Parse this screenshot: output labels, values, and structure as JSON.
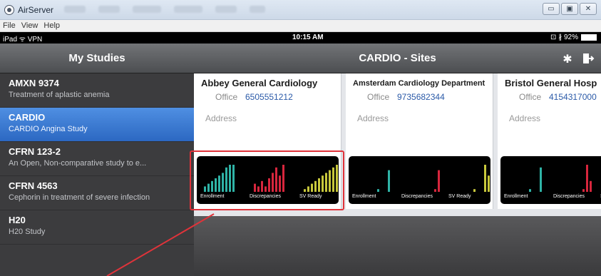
{
  "window": {
    "title": "AirServer",
    "menu": [
      "File",
      "View",
      "Help"
    ]
  },
  "status_bar": {
    "left": "iPad ᯤ VPN",
    "time": "10:15 AM",
    "battery": "⊡ ∦ 92%"
  },
  "left_panel": {
    "title": "My Studies",
    "studies": [
      {
        "name": "AMXN 9374",
        "desc": "Treatment of aplastic anemia"
      },
      {
        "name": "CARDIO",
        "desc": "CARDIO Angina Study"
      },
      {
        "name": "CFRN 123-2",
        "desc": "An Open, Non-comparative study to e..."
      },
      {
        "name": "CFRN 4563",
        "desc": "Cephorin in treatment of severe infection"
      },
      {
        "name": "H20",
        "desc": "H20 Study"
      }
    ]
  },
  "right_panel": {
    "title": "CARDIO - Sites",
    "sites": [
      {
        "name": "Abbey General Cardiology",
        "office_label": "Office",
        "phone": "6505551212",
        "address_label": "Address",
        "chart_labels": [
          "Enrollment",
          "Discrepancies",
          "SV Ready"
        ]
      },
      {
        "name": "Amsterdam Cardiology Department",
        "office_label": "Office",
        "phone": "9735682344",
        "address_label": "Address",
        "chart_labels": [
          "Enrollment",
          "Discrepancies",
          "SV Ready"
        ]
      },
      {
        "name": "Bristol General Hosp",
        "office_label": "Office",
        "phone": "4154317000",
        "address_label": "Address",
        "chart_labels": [
          "Enrollment",
          "Discrepancies",
          "S"
        ]
      }
    ]
  },
  "colors": {
    "enrollment": "#2fb3a6",
    "discrepancies": "#d7263d",
    "sv_ready": "#c8c83c",
    "accent": "#2c68c2"
  },
  "chart_data": [
    {
      "type": "bar",
      "title": "",
      "series": [
        {
          "name": "Enrollment",
          "values": [
            2,
            3,
            4,
            5,
            6,
            7,
            9,
            10,
            10
          ]
        },
        {
          "name": "Discrepancies",
          "values": [
            3,
            2,
            4,
            2,
            5,
            7,
            9,
            6,
            10
          ]
        },
        {
          "name": "SV Ready",
          "values": [
            1,
            2,
            3,
            4,
            5,
            6,
            7,
            8,
            9,
            10
          ]
        }
      ]
    },
    {
      "type": "bar",
      "title": "",
      "series": [
        {
          "name": "Enrollment",
          "values": [
            1,
            0,
            0,
            8
          ]
        },
        {
          "name": "Discrepancies",
          "values": [
            0,
            0,
            1,
            8
          ]
        },
        {
          "name": "SV Ready",
          "values": [
            1,
            0,
            0,
            10,
            6
          ]
        }
      ]
    },
    {
      "type": "bar",
      "title": "",
      "series": [
        {
          "name": "Enrollment",
          "values": [
            1,
            0,
            0,
            9
          ]
        },
        {
          "name": "Discrepancies",
          "values": [
            0,
            0,
            1,
            10,
            4
          ]
        }
      ]
    }
  ]
}
